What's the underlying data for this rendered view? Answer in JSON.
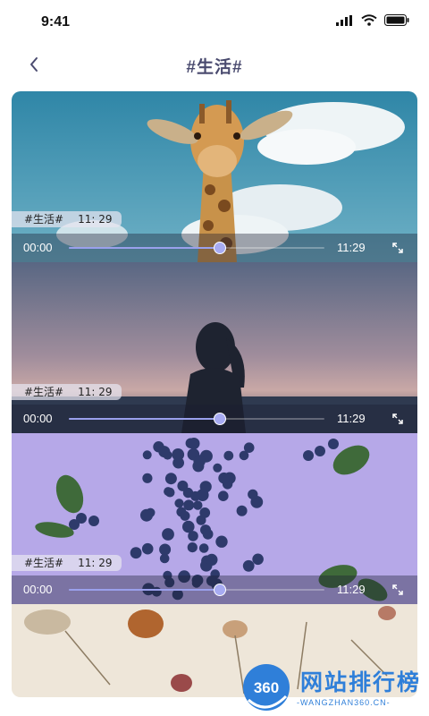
{
  "status": {
    "time": "9:41"
  },
  "header": {
    "title": "#生活#",
    "back_icon": "chevron-left-icon"
  },
  "videos": [
    {
      "tag": "#生活#",
      "duration": "11: 29",
      "start_time": "00:00",
      "end_time": "11:29",
      "progress": 0.59
    },
    {
      "tag": "#生活#",
      "duration": "11: 29",
      "start_time": "00:00",
      "end_time": "11:29",
      "progress": 0.59
    },
    {
      "tag": "#生活#",
      "duration": "11: 29",
      "start_time": "00:00",
      "end_time": "11:29",
      "progress": 0.59
    }
  ],
  "watermark": {
    "logo": "360",
    "text": "网站排行榜",
    "subtext": "-WANGZHAN360.CN-"
  },
  "colors": {
    "title": "#4a4b6f",
    "progress": "#9aa0ec",
    "card3_bg": "#b6a8e8"
  }
}
